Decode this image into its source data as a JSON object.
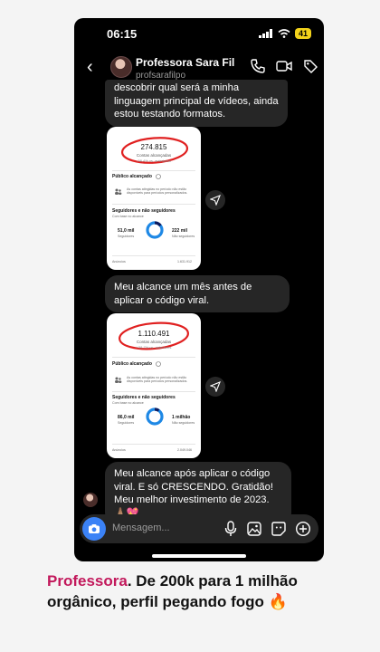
{
  "status_bar": {
    "time": "06:15",
    "battery": "41"
  },
  "header": {
    "name": "Professora Sara Fil...",
    "handle": "profsarafilpo"
  },
  "messages": [
    {
      "text": "descobrir qual será a minha linguagem principal de vídeos, ainda estou testando formatos."
    },
    {
      "text": "Meu alcance um mês antes de aplicar o código viral."
    },
    {
      "text": "Meu alcance após aplicar o código viral. E só CRESCENDO. Gratidão! Meu melhor investimento de 2023. 🙏🏽💖"
    }
  ],
  "cards": [
    {
      "number": "274.815",
      "label": "Contas alcançadas",
      "sub": "-38,4% vs. anteriores",
      "section": "Público alcançado",
      "section_text": "As contas atingidas no período não estão disponíveis para períodos personalizados.",
      "followers_title": "Seguidores e não seguidores",
      "followers_sub": "Com base no alcance",
      "left_stat": "51,0 mil",
      "left_label": "Seguidores",
      "right_stat": "222 mil",
      "right_label": "Não seguidores",
      "footer_left": "Anúncios",
      "footer_right": "1.631.912"
    },
    {
      "number": "1.110.491",
      "label": "Contas alcançadas",
      "sub": "+38,7% vs. anteriores",
      "section": "Público alcançado",
      "section_text": "As contas atingidas no período não estão disponíveis para períodos personalizados.",
      "followers_title": "Seguidores e não seguidores",
      "followers_sub": "Com base no alcance",
      "left_stat": "86,0 mil",
      "left_label": "Seguidores",
      "right_stat": "1 milhão",
      "right_label": "Não seguidores",
      "footer_left": "Anúncios",
      "footer_right": "2.049.046"
    }
  ],
  "input": {
    "placeholder": "Mensagem..."
  },
  "caption": {
    "highlight": "Professora",
    "rest": ". De 200k para 1 milhão orgânico, perfil pegando fogo 🔥"
  },
  "colors": {
    "accent": "#c2185b",
    "camera": "#3b82f6",
    "bubble": "#262626",
    "annotation": "#e02020"
  },
  "icons": [
    "back-arrow-icon",
    "phone-icon",
    "video-icon",
    "tag-icon",
    "share-icon",
    "camera-icon",
    "microphone-icon",
    "gallery-icon",
    "sticker-icon",
    "plus-icon"
  ]
}
